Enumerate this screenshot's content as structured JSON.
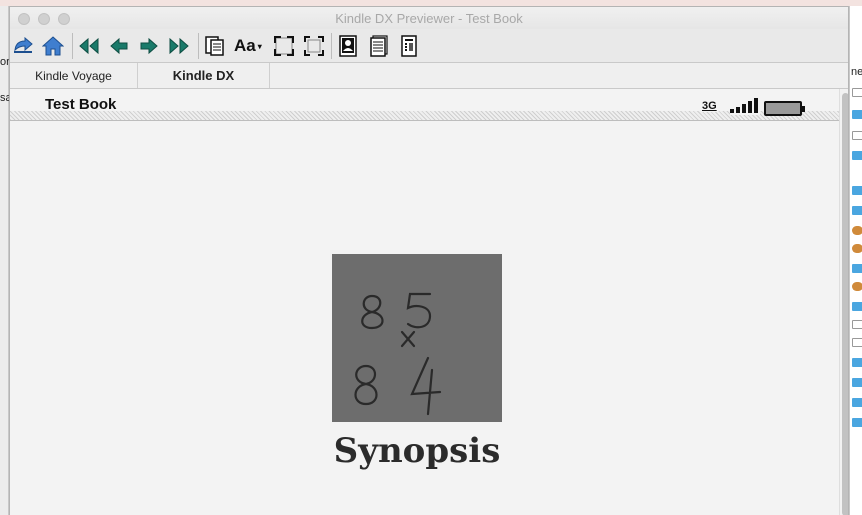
{
  "window": {
    "title": "Kindle DX Previewer - Test Book"
  },
  "toolbar": {
    "font_label": "Aa",
    "font_caret": "▾"
  },
  "tabs": [
    {
      "label": "Kindle Voyage",
      "active": false
    },
    {
      "label": "Kindle DX",
      "active": true
    }
  ],
  "device": {
    "book_title": "Test Book",
    "network_label": "3G",
    "signal_bars": 5,
    "battery_level": 1.0,
    "cover_handwriting": "85 × 84",
    "heading": "Synopsis"
  },
  "background": {
    "left_fragments": [
      "or",
      "sa"
    ],
    "right_fragment": "ne"
  },
  "colors": {
    "icon_blue": "#3f7ecf",
    "icon_teal": "#1a7a6a",
    "cover_gray": "#6d6d6d"
  }
}
